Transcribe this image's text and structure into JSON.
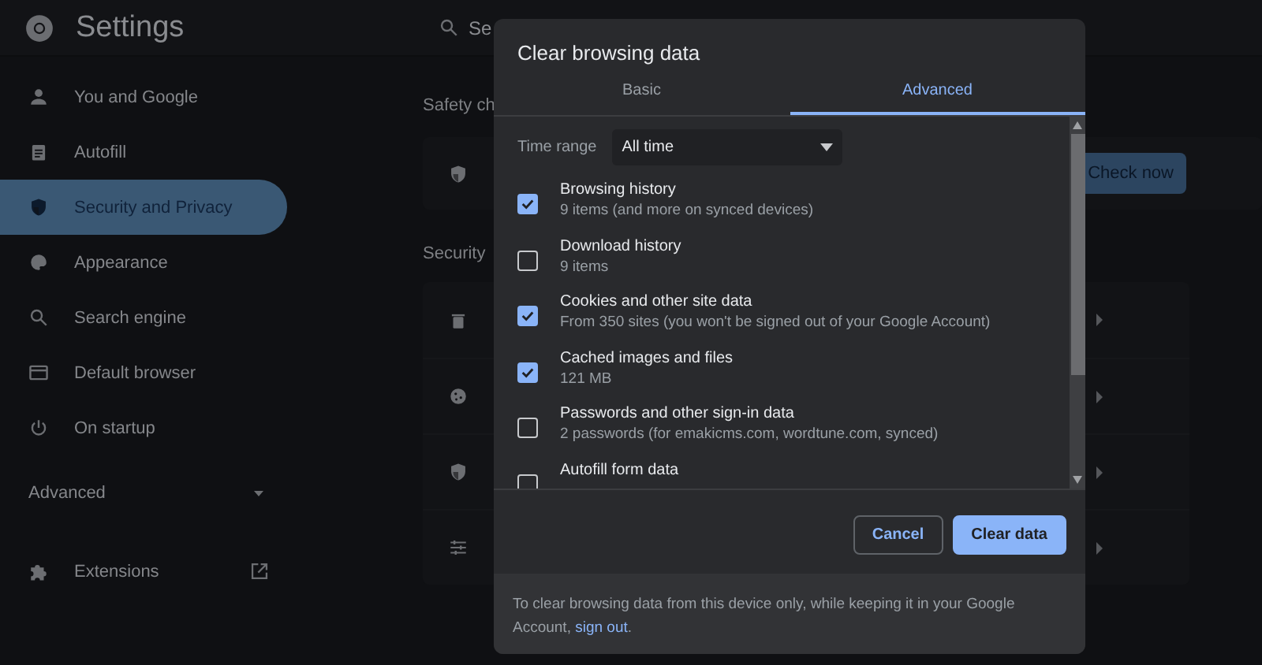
{
  "header": {
    "title": "Settings",
    "search_placeholder": "Se"
  },
  "sidebar": {
    "items": [
      {
        "label": "You and Google",
        "selected": false
      },
      {
        "label": "Autofill",
        "selected": false
      },
      {
        "label": "Security and Privacy",
        "selected": true
      },
      {
        "label": "Appearance",
        "selected": false
      },
      {
        "label": "Search engine",
        "selected": false
      },
      {
        "label": "Default browser",
        "selected": false
      },
      {
        "label": "On startup",
        "selected": false
      }
    ],
    "advanced": {
      "label": "Advanced",
      "expanded": false
    },
    "extensions": {
      "label": "Extensions"
    }
  },
  "main": {
    "safety_heading": "Safety ch",
    "check_button": "Check now",
    "security_heading": "Security"
  },
  "dialog": {
    "title": "Clear browsing data",
    "tabs": [
      {
        "label": "Basic",
        "selected": false
      },
      {
        "label": "Advanced",
        "selected": true
      }
    ],
    "time_range": {
      "label": "Time range",
      "value": "All time"
    },
    "items": [
      {
        "title": "Browsing history",
        "detail": "9 items (and more on synced devices)",
        "checked": true
      },
      {
        "title": "Download history",
        "detail": "9 items",
        "checked": false
      },
      {
        "title": "Cookies and other site data",
        "detail": "From 350 sites (you won't be signed out of your Google Account)",
        "checked": true
      },
      {
        "title": "Cached images and files",
        "detail": "121 MB",
        "checked": true
      },
      {
        "title": "Passwords and other sign-in data",
        "detail": "2 passwords (for emakicms.com, wordtune.com, synced)",
        "checked": false
      },
      {
        "title": "Autofill form data",
        "checked": false
      }
    ],
    "buttons": [
      {
        "label": "Cancel",
        "kind": "secondary"
      },
      {
        "label": "Clear data",
        "kind": "primary"
      }
    ],
    "footer": {
      "text": "To clear browsing data from this device only, while keeping it in your Google Account, ",
      "link": "sign out",
      "after": "."
    }
  }
}
